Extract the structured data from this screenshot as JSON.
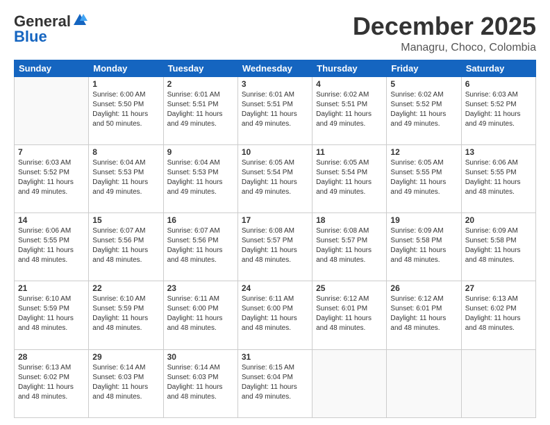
{
  "header": {
    "logo_general": "General",
    "logo_blue": "Blue",
    "month_title": "December 2025",
    "subtitle": "Managru, Choco, Colombia"
  },
  "days_of_week": [
    "Sunday",
    "Monday",
    "Tuesday",
    "Wednesday",
    "Thursday",
    "Friday",
    "Saturday"
  ],
  "weeks": [
    [
      {
        "day": "",
        "info": ""
      },
      {
        "day": "1",
        "info": "Sunrise: 6:00 AM\nSunset: 5:50 PM\nDaylight: 11 hours\nand 50 minutes."
      },
      {
        "day": "2",
        "info": "Sunrise: 6:01 AM\nSunset: 5:51 PM\nDaylight: 11 hours\nand 49 minutes."
      },
      {
        "day": "3",
        "info": "Sunrise: 6:01 AM\nSunset: 5:51 PM\nDaylight: 11 hours\nand 49 minutes."
      },
      {
        "day": "4",
        "info": "Sunrise: 6:02 AM\nSunset: 5:51 PM\nDaylight: 11 hours\nand 49 minutes."
      },
      {
        "day": "5",
        "info": "Sunrise: 6:02 AM\nSunset: 5:52 PM\nDaylight: 11 hours\nand 49 minutes."
      },
      {
        "day": "6",
        "info": "Sunrise: 6:03 AM\nSunset: 5:52 PM\nDaylight: 11 hours\nand 49 minutes."
      }
    ],
    [
      {
        "day": "7",
        "info": "Sunrise: 6:03 AM\nSunset: 5:52 PM\nDaylight: 11 hours\nand 49 minutes."
      },
      {
        "day": "8",
        "info": "Sunrise: 6:04 AM\nSunset: 5:53 PM\nDaylight: 11 hours\nand 49 minutes."
      },
      {
        "day": "9",
        "info": "Sunrise: 6:04 AM\nSunset: 5:53 PM\nDaylight: 11 hours\nand 49 minutes."
      },
      {
        "day": "10",
        "info": "Sunrise: 6:05 AM\nSunset: 5:54 PM\nDaylight: 11 hours\nand 49 minutes."
      },
      {
        "day": "11",
        "info": "Sunrise: 6:05 AM\nSunset: 5:54 PM\nDaylight: 11 hours\nand 49 minutes."
      },
      {
        "day": "12",
        "info": "Sunrise: 6:05 AM\nSunset: 5:55 PM\nDaylight: 11 hours\nand 49 minutes."
      },
      {
        "day": "13",
        "info": "Sunrise: 6:06 AM\nSunset: 5:55 PM\nDaylight: 11 hours\nand 48 minutes."
      }
    ],
    [
      {
        "day": "14",
        "info": "Sunrise: 6:06 AM\nSunset: 5:55 PM\nDaylight: 11 hours\nand 48 minutes."
      },
      {
        "day": "15",
        "info": "Sunrise: 6:07 AM\nSunset: 5:56 PM\nDaylight: 11 hours\nand 48 minutes."
      },
      {
        "day": "16",
        "info": "Sunrise: 6:07 AM\nSunset: 5:56 PM\nDaylight: 11 hours\nand 48 minutes."
      },
      {
        "day": "17",
        "info": "Sunrise: 6:08 AM\nSunset: 5:57 PM\nDaylight: 11 hours\nand 48 minutes."
      },
      {
        "day": "18",
        "info": "Sunrise: 6:08 AM\nSunset: 5:57 PM\nDaylight: 11 hours\nand 48 minutes."
      },
      {
        "day": "19",
        "info": "Sunrise: 6:09 AM\nSunset: 5:58 PM\nDaylight: 11 hours\nand 48 minutes."
      },
      {
        "day": "20",
        "info": "Sunrise: 6:09 AM\nSunset: 5:58 PM\nDaylight: 11 hours\nand 48 minutes."
      }
    ],
    [
      {
        "day": "21",
        "info": "Sunrise: 6:10 AM\nSunset: 5:59 PM\nDaylight: 11 hours\nand 48 minutes."
      },
      {
        "day": "22",
        "info": "Sunrise: 6:10 AM\nSunset: 5:59 PM\nDaylight: 11 hours\nand 48 minutes."
      },
      {
        "day": "23",
        "info": "Sunrise: 6:11 AM\nSunset: 6:00 PM\nDaylight: 11 hours\nand 48 minutes."
      },
      {
        "day": "24",
        "info": "Sunrise: 6:11 AM\nSunset: 6:00 PM\nDaylight: 11 hours\nand 48 minutes."
      },
      {
        "day": "25",
        "info": "Sunrise: 6:12 AM\nSunset: 6:01 PM\nDaylight: 11 hours\nand 48 minutes."
      },
      {
        "day": "26",
        "info": "Sunrise: 6:12 AM\nSunset: 6:01 PM\nDaylight: 11 hours\nand 48 minutes."
      },
      {
        "day": "27",
        "info": "Sunrise: 6:13 AM\nSunset: 6:02 PM\nDaylight: 11 hours\nand 48 minutes."
      }
    ],
    [
      {
        "day": "28",
        "info": "Sunrise: 6:13 AM\nSunset: 6:02 PM\nDaylight: 11 hours\nand 48 minutes."
      },
      {
        "day": "29",
        "info": "Sunrise: 6:14 AM\nSunset: 6:03 PM\nDaylight: 11 hours\nand 48 minutes."
      },
      {
        "day": "30",
        "info": "Sunrise: 6:14 AM\nSunset: 6:03 PM\nDaylight: 11 hours\nand 48 minutes."
      },
      {
        "day": "31",
        "info": "Sunrise: 6:15 AM\nSunset: 6:04 PM\nDaylight: 11 hours\nand 49 minutes."
      },
      {
        "day": "",
        "info": ""
      },
      {
        "day": "",
        "info": ""
      },
      {
        "day": "",
        "info": ""
      }
    ]
  ]
}
